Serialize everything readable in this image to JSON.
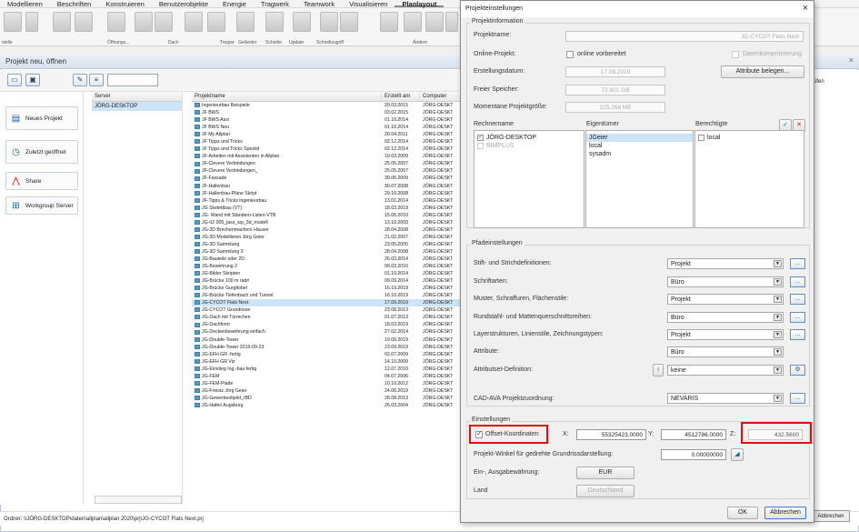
{
  "ribbon": {
    "tabs": [
      "Modellieren",
      "Beschriften",
      "Konstruieren",
      "Benutzerobjekte",
      "Energie",
      "Tragwerk",
      "Teamwork",
      "Visualisieren",
      "Planlayout"
    ],
    "labels": [
      "stelle",
      "Öffnungs...",
      "Dach",
      "Treppe",
      "Geländer",
      "Schnitte",
      "Update",
      "Schnellzugriff",
      "Ändern"
    ]
  },
  "main": {
    "title": "Projekt neu, öffnen",
    "left_buttons": [
      "Neues Projekt",
      "Zuletzt geöffnet",
      "Share",
      "Workgroup Server"
    ],
    "server_header": "Server",
    "server_value": "JÖRG-DESKTOP",
    "table_headers": [
      "Projektname",
      "Erstellt am",
      "Computer"
    ],
    "rows": [
      [
        "Ingenieurbau Beispiele",
        "20.03.2015",
        "JÖRG-DESKT"
      ],
      [
        "JF BWS",
        "03.02.2015",
        "JÖRG-DESKT"
      ],
      [
        "JF BWS Assi",
        "01.10.2014",
        "JÖRG-DESKT"
      ],
      [
        "JF BWS Neu",
        "01.10.2014",
        "JÖRG-DESKT"
      ],
      [
        "JF My Allplan",
        "20.04.2011",
        "JÖRG-DESKT"
      ],
      [
        "JF Tipps und Tricks",
        "02.12.2014",
        "JÖRG-DESKT"
      ],
      [
        "JF Tipps und Tricks Spezial",
        "02.12.2014",
        "JÖRG-DESKT"
      ],
      [
        "JF-Arbeiten mit Assistenten in Allplan",
        "10.03.2009",
        "JÖRG-DESKT"
      ],
      [
        "JF-Clevere Verbindungen",
        "25.05.2007",
        "JÖRG-DESKT"
      ],
      [
        "JF-Clevere Verbindungen_",
        "25.05.2007",
        "JÖRG-DESKT"
      ],
      [
        "JF-Fassade",
        "30.06.2009",
        "JÖRG-DESKT"
      ],
      [
        "JF-Hallenbau",
        "30.07.2008",
        "JÖRG-DESKT"
      ],
      [
        "JF-Hallenbau-Pläne Skript",
        "29.10.2008",
        "JÖRG-DESKT"
      ],
      [
        "JF-Tipps & Tricks ingenieurbau",
        "13.01.2014",
        "JÖRG-DESKT"
      ],
      [
        "JG Skelettbau (VT)",
        "18.03.2019",
        "JÖRG-DESKT"
      ],
      [
        "JG- Wand mit Ständern-Listen-VTB",
        "15.06.2010",
        "JÖRG-DESKT"
      ],
      [
        "JG-02 005_jass_wp_3d_modell",
        "13.10.2003",
        "JÖRG-DESKT"
      ],
      [
        "JG-3D Brechenmachers Häuser",
        "28.04.2008",
        "JÖRG-DESKT"
      ],
      [
        "JG-3D Modellieren Jörg Geier",
        "21.02.2007",
        "JÖRG-DESKT"
      ],
      [
        "JG-3D Sammlung",
        "23.05.2005",
        "JÖRG-DESKT"
      ],
      [
        "JG-3D Sammlung 3",
        "28.04.2008",
        "JÖRG-DESKT"
      ],
      [
        "JG-Bauteile oder 2D",
        "26.03.2014",
        "JÖRG-DESKT"
      ],
      [
        "JG-Bewehrung 2",
        "09.03.2016",
        "JÖRG-DESKT"
      ],
      [
        "JG-Bilder Skripten",
        "01.10.2014",
        "JÖRG-DESKT"
      ],
      [
        "JG-Brücke 100 m rad#",
        "09.09.2014",
        "JÖRG-DESKT"
      ],
      [
        "JG-Brücke Gurgltobel",
        "16.10.2019",
        "JÖRG-DESKT"
      ],
      [
        "JG-Brücke Tiefenbach und Tunnel",
        "16.10.2019",
        "JÖRG-DESKT"
      ],
      [
        "JG-CYCOT Flats Next",
        "17.09.2019",
        "JÖRG-DESKT"
      ],
      [
        "JG-CYCOT Grundrisse",
        "23.08.2013",
        "JÖRG-DESKT"
      ],
      [
        "JG-Dach mit Türmchen",
        "01.07.2013",
        "JÖRG-DESKT"
      ],
      [
        "JG-Dachform",
        "18.03.2019",
        "JÖRG-DESKT"
      ],
      [
        "JG-Deckenbewehrung einfach",
        "27.02.2014",
        "JÖRG-DESKT"
      ],
      [
        "JG-Double-Tower",
        "19.09.2019",
        "JÖRG-DESKT"
      ],
      [
        "JG-Double-Tower 2019-09-23",
        "23.09.2019",
        "JÖRG-DESKT"
      ],
      [
        "JG-EFH GR -fertig",
        "02.07.2009",
        "JÖRG-DESKT"
      ],
      [
        "JG-EFH GR Viz",
        "14.10.2009",
        "JÖRG-DESKT"
      ],
      [
        "JG-Einstieg Ing.-bau fertig",
        "12.07.2010",
        "JÖRG-DESKT"
      ],
      [
        "JG-FEM",
        "04.07.2006",
        "JÖRG-DESKT"
      ],
      [
        "JG-FEM-Platte",
        "10.10.2012",
        "JÖRG-DESKT"
      ],
      [
        "JG-Freistz Jörg Geier",
        "24.06.2019",
        "JÖRG-DESKT"
      ],
      [
        "JG-Gewerbeobjekt_IBD",
        "28.08.2013",
        "JÖRG-DESKT"
      ],
      [
        "JG-Hafen Augsburg",
        "26.03.2004",
        "JÖRG-DESKT"
      ]
    ],
    "selected_index": 27,
    "status": "Ordner: \\\\JÖRG-DESKTOP\\daten\\allplan\\allplan 2020\\prj\\JG-CYCOT Flats Next.prj",
    "right_text": "üfen",
    "abbrechen_bg": "Abbrechen"
  },
  "dialog": {
    "title": "Projekteinstellungen",
    "group_info": "Projektinformation",
    "name_label": "Projektname:",
    "name_value": "JG-CYCOT Flats Next",
    "online_label": "Online-Projekt:",
    "online_check": "online vorbereitet",
    "compress_label": "Datenkomprimierung",
    "created_label": "Erstellungsdatum:",
    "created_value": "17.09.2019",
    "attr_button": "Attribute belegen...",
    "free_label": "Freier Speicher:",
    "free_value": "72.901 GB",
    "size_label": "Momentane Projektgröße:",
    "size_value": "225.268 MB",
    "col_rechner": "Rechnername",
    "col_owner": "Eigentümer",
    "col_rights": "Berechtigte",
    "rechner": [
      "JÖRG-DESKTOP",
      "BIMPLUS"
    ],
    "owners": [
      "JGeier",
      "local",
      "sysadm"
    ],
    "rights": [
      "local"
    ],
    "group_paths": "Pfadeinstellungen",
    "paths": [
      {
        "label": "Stift- und Strichdefinitionen:",
        "value": "Projekt"
      },
      {
        "label": "Schriftarten:",
        "value": "Büro"
      },
      {
        "label": "Muster, Schraffuren, Flächenstile:",
        "value": "Projekt"
      },
      {
        "label": "Rundstahl- und Mattenquerschnittsreihen:",
        "value": "Büro"
      },
      {
        "label": "Layerstrukturen, Linienstile, Zeichnungstypen:",
        "value": "Projekt"
      },
      {
        "label": "Attribute:",
        "value": "Büro"
      },
      {
        "label": "Attributset-Definition:",
        "value": "keine"
      }
    ],
    "cad_label": "CAD-AVA Projektzuordnung:",
    "cad_value": "NEVARIS",
    "group_settings": "Einstellungen",
    "offset_label": "Offset-Koordinaten",
    "x_label": "X:",
    "x_value": "55325423.0000",
    "y_label": "Y:",
    "y_value": "4512786.0000",
    "z_label": "Z:",
    "z_value": "432.5600",
    "angle_label": "Projekt-Winkel für gedrehte Grundrissdarstellung:",
    "angle_value": "0.00000000",
    "currency_label": "Ein-, Ausgabewährung:",
    "currency_value": "EUR",
    "country_label": "Land",
    "country_value": "Deutschland",
    "ok": "OK",
    "cancel": "Abbrechen"
  }
}
